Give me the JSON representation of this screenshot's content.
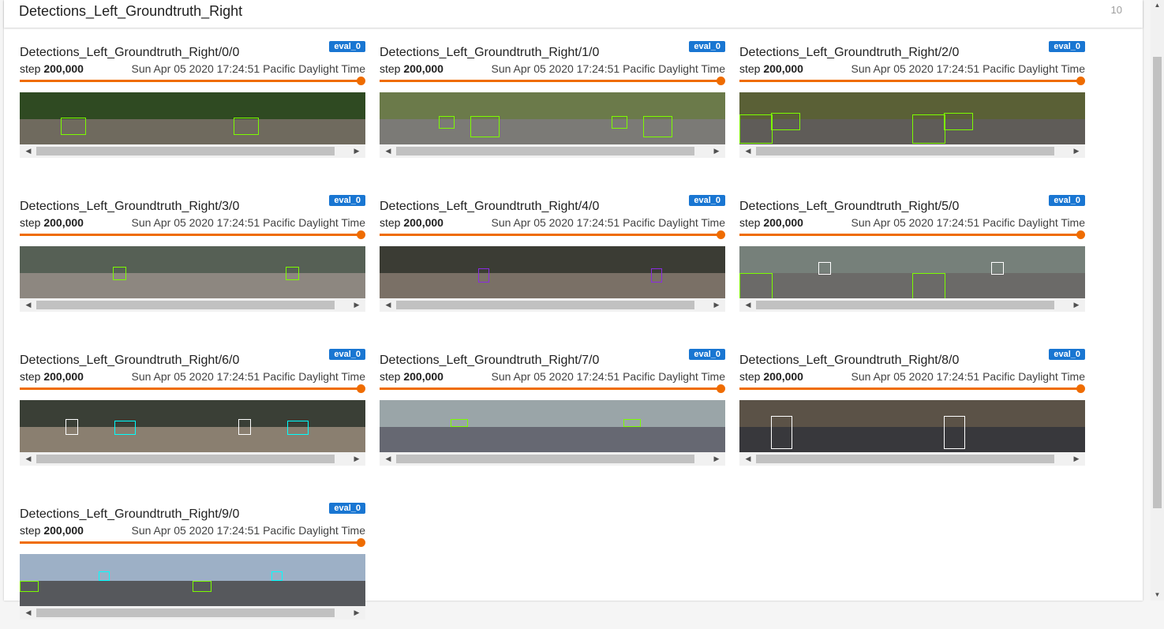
{
  "header": {
    "title": "Detections_Left_Groundtruth_Right",
    "count": "10"
  },
  "run_tag": "eval_0",
  "step_label": "step",
  "step_value": "200,000",
  "wall_time": "Sun Apr 05 2020 17:24:51 Pacific Daylight Time",
  "slider_position": 1.0,
  "colors": {
    "accent": "#ef6c00",
    "run_badge": "#1976d2",
    "detection_box": "#7CFC00",
    "groundtruth_box": "#00FFFF"
  },
  "icons": {
    "scroll_left": "arrow-left-icon",
    "scroll_right": "arrow-right-icon",
    "scroll_up": "arrow-up-icon",
    "scroll_down": "arrow-down-icon"
  },
  "cards": [
    {
      "tag": "Detections_Left_Groundtruth_Right/0/0"
    },
    {
      "tag": "Detections_Left_Groundtruth_Right/1/0"
    },
    {
      "tag": "Detections_Left_Groundtruth_Right/2/0"
    },
    {
      "tag": "Detections_Left_Groundtruth_Right/3/0"
    },
    {
      "tag": "Detections_Left_Groundtruth_Right/4/0"
    },
    {
      "tag": "Detections_Left_Groundtruth_Right/5/0"
    },
    {
      "tag": "Detections_Left_Groundtruth_Right/6/0"
    },
    {
      "tag": "Detections_Left_Groundtruth_Right/7/0"
    },
    {
      "tag": "Detections_Left_Groundtruth_Right/8/0"
    },
    {
      "tag": "Detections_Left_Groundtruth_Right/9/0"
    }
  ]
}
